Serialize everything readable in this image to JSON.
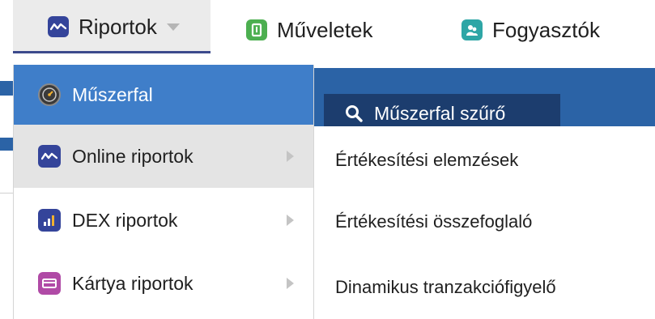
{
  "topnav": {
    "riportok": {
      "label": "Riportok",
      "icon": "report-wave-icon"
    },
    "muveletek": {
      "label": "Műveletek",
      "icon": "operations-icon"
    },
    "fogyasztok": {
      "label": "Fogyasztók",
      "icon": "consumers-icon"
    }
  },
  "filter_button": {
    "label": "Műszerfal szűrő",
    "icon": "search-icon"
  },
  "dropdown": {
    "items": [
      {
        "label": "Műszerfal",
        "icon": "dashboard-gauge-icon",
        "state": "selected"
      },
      {
        "label": "Online riportok",
        "icon": "report-wave-icon",
        "state": "hover",
        "has_submenu": true
      },
      {
        "label": "DEX riportok",
        "icon": "bar-chart-icon",
        "has_submenu": true
      },
      {
        "label": "Kártya riportok",
        "icon": "card-icon",
        "has_submenu": true
      }
    ]
  },
  "submenu": {
    "items": [
      {
        "label": "Értékesítési elemzések"
      },
      {
        "label": "Értékesítési összefoglaló"
      },
      {
        "label": "Dinamikus tranzakciófigyelő"
      }
    ]
  },
  "colors": {
    "accent_blue": "#3f7ec9",
    "dark_blue": "#1c3d6e",
    "report_icon": "#34449a",
    "ops_icon": "#4caf50",
    "cust_icon": "#2ea6a6",
    "card_icon": "#b04aa6"
  }
}
